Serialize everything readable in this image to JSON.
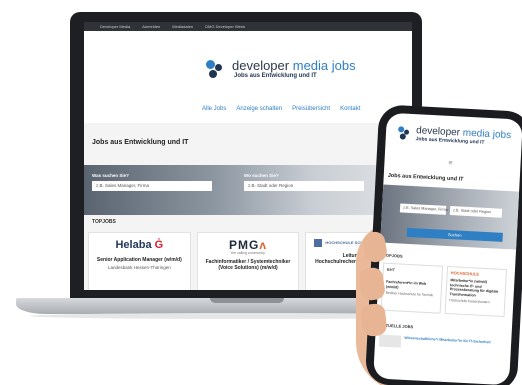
{
  "laptop": {
    "topbar": [
      "Developer Media",
      "Anmelden",
      "Mediadaten",
      "DMG Developer Week"
    ],
    "logo": {
      "word1": "developer",
      "word2": "media jobs",
      "tagline": "Jobs aus Entwicklung und IT"
    },
    "nav": [
      "Alle Jobs",
      "Anzeige schalten",
      "Preisübersicht",
      "Kontakt"
    ],
    "section_title": "Jobs aus Entwicklung und IT",
    "search": {
      "what_label": "Was suchen Sie?",
      "what_placeholder": "z.B. Sales Manager, Firma",
      "where_label": "Wo suchen Sie?",
      "where_placeholder": "z.B. Stadt oder Region"
    },
    "topjobs_heading": "TOPJOBS",
    "cards": [
      {
        "company": "Helaba",
        "mark": "Ġ",
        "title": "Senior Application Manager (w/m/d)",
        "subtitle": "Landesbank Hessen-Thüringen"
      },
      {
        "company": "PMG",
        "mark": "ᴧ",
        "tagline": "the calling community",
        "title": "Fachinformatiker / Systemtechniker (Voice Solutions) (m/w/d)",
        "subtitle": ""
      },
      {
        "company": "HOCHSCHULE SCHMALKALDEN",
        "title": "Leitung des Hochschulrechenzentrums (m/w/d)",
        "subtitle": ""
      }
    ]
  },
  "phone": {
    "logo": {
      "word1": "developer",
      "word2": "media jobs",
      "tagline": "Jobs aus Entwicklung und IT"
    },
    "menu_icon": "≡",
    "title": "Jobs aus Entwicklung und IT",
    "what_placeholder": "z.B. Sales Manager, Firma",
    "where_placeholder": "z.B. Stadt oder Region",
    "search_button": "Suchen",
    "topjobs_heading": "TOPJOBS",
    "cards": [
      {
        "company": "BHT",
        "title": "Fachreferent*in im Web (w/m/d)",
        "subtitle": "Berliner Hochschule für Technik"
      },
      {
        "company": "HOCHSCHULE",
        "title": "Mitarbeiter*in (w/m/d) technische IT- und Prozessberatung für digitale Transformation",
        "subtitle": "Hochschule Kaiserslautern"
      }
    ],
    "aktuell_heading": "AKTUELLE JOBS",
    "job": "Wissenschaftliche*r Mitarbeiter*in für IT-Sicherheit"
  },
  "colors": {
    "brand_blue": "#2f7fc4",
    "navy": "#1f3552",
    "helaba_red": "#d2212e",
    "pmg_orange": "#e2612f"
  }
}
